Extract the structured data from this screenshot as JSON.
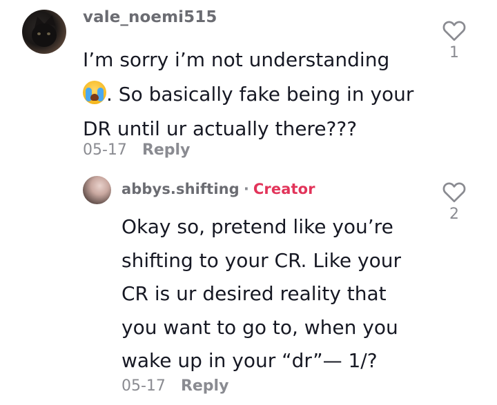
{
  "comments": [
    {
      "username": "vale_noemi515",
      "lines": [
        "I’m sorry i’m not understanding",
        ". So basically fake being in your",
        "DR until ur actually there???"
      ],
      "emoji": "loudly-crying-face-emoji",
      "date": "05-17",
      "reply_label": "Reply",
      "like_count": "1",
      "avatar": "cat-avatar"
    }
  ],
  "replies": [
    {
      "username": "abbys.shifting",
      "separator": "·",
      "badge": "Creator",
      "lines": [
        "Okay so, pretend like you’re",
        "shifting to your CR. Like your",
        "CR is ur desired reality that",
        "you want to go to, when you",
        "wake up in your “dr”— 1/?"
      ],
      "date": "05-17",
      "reply_label": "Reply",
      "like_count": "2",
      "avatar": "profile-avatar"
    }
  ],
  "colors": {
    "text": "#161823",
    "muted": "#8a8b91",
    "username": "#6b6c72",
    "creator": "#e2345a"
  },
  "icons": {
    "like": "heart-outline-icon"
  }
}
